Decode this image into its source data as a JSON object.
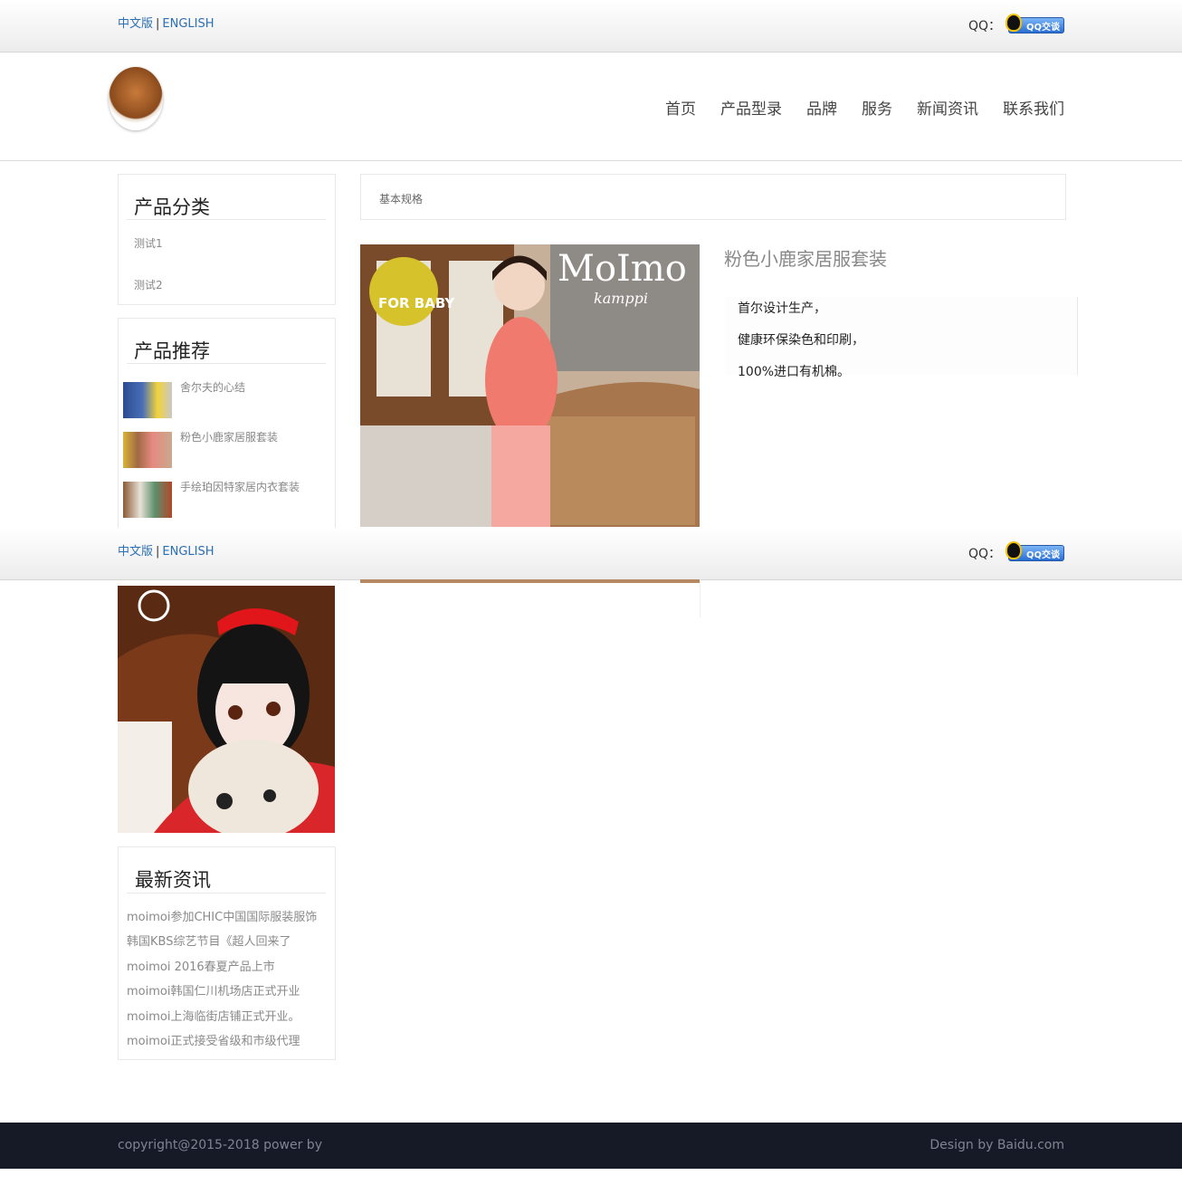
{
  "topbar": {
    "lang_cn": "中文版",
    "lang_sep": "|",
    "lang_en": "ENGLISH",
    "qq_label": "QQ：",
    "qq_button": "QQ交谈"
  },
  "nav": {
    "items": [
      "首页",
      "产品型录",
      "品牌",
      "服务",
      "新闻资讯",
      "联系我们"
    ]
  },
  "sidebar": {
    "category_title": "产品分类",
    "categories": [
      "测试1",
      "测试2"
    ],
    "recommend_title": "产品推荐",
    "recommendations": [
      "舍尔夫的心结",
      "粉色小鹿家居服套装",
      "手绘珀因特家居内衣套装"
    ],
    "news_title": "最新资讯",
    "news": [
      "moimoi参加CHIC中国国际服装服饰",
      "韩国KBS综艺节目《超人回来了",
      "moimoi 2016春夏产品上市",
      "moimoi韩国仁川机场店正式开业",
      "moimoi上海临街店铺正式开业。",
      "moimoi正式接受省级和市级代理"
    ]
  },
  "main": {
    "breadcrumb": "基本规格",
    "image_badge": "FOR BABY",
    "image_brand": "MoImo",
    "image_script": "kamppi",
    "product_title": "粉色小鹿家居服套装",
    "description": [
      "首尔设计生产，",
      "健康环保染色和印刷，",
      "100%进口有机棉。"
    ]
  },
  "footer": {
    "copyright": "copyright@2015-2018 power by",
    "design": "Design by Baidu.com"
  }
}
